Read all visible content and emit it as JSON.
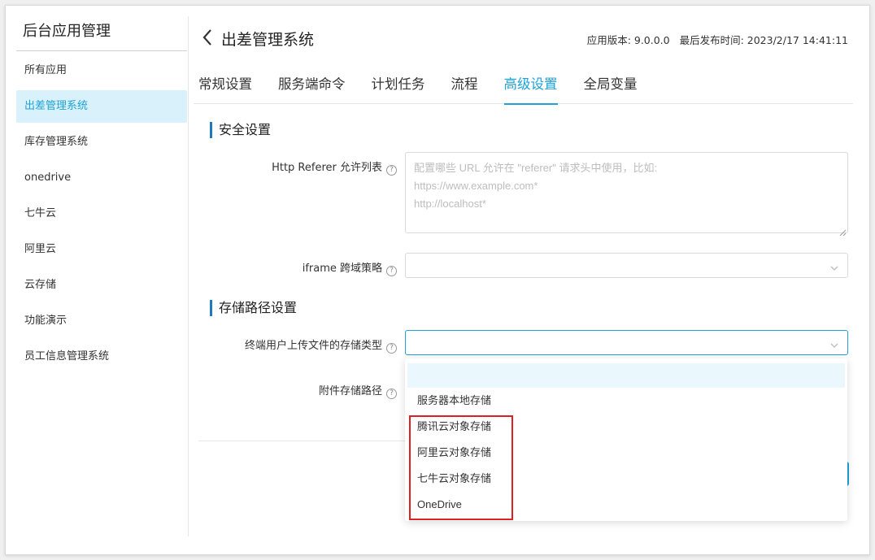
{
  "sidebar": {
    "title": "后台应用管理",
    "items": [
      {
        "label": "所有应用"
      },
      {
        "label": "出差管理系统"
      },
      {
        "label": "库存管理系统"
      },
      {
        "label": "onedrive"
      },
      {
        "label": "七牛云"
      },
      {
        "label": "阿里云"
      },
      {
        "label": "云存储"
      },
      {
        "label": "功能演示"
      },
      {
        "label": "员工信息管理系统"
      }
    ]
  },
  "header": {
    "title": "出差管理系统",
    "version": "应用版本: 9.0.0.0",
    "published": "最后发布时间: 2023/2/17 14:41:11"
  },
  "tabs": [
    {
      "label": "常规设置"
    },
    {
      "label": "服务端命令"
    },
    {
      "label": "计划任务"
    },
    {
      "label": "流程"
    },
    {
      "label": "高级设置"
    },
    {
      "label": "全局变量"
    }
  ],
  "security": {
    "title": "安全设置",
    "referer_label": "Http Referer 允许列表",
    "referer_placeholder": "配置哪些 URL 允许在 \"referer\" 请求头中使用，比如:\nhttps://www.example.com*\nhttp://localhost*",
    "iframe_label": "iframe 跨域策略",
    "iframe_value": ""
  },
  "storage": {
    "title": "存储路径设置",
    "upload_type_label": "终端用户上传文件的存储类型",
    "upload_type_value": "",
    "attachment_label": "附件存储路径",
    "options": [
      "",
      "服务器本地存储",
      "腾讯云对象存储",
      "阿里云对象存储",
      "七牛云对象存储",
      "OneDrive"
    ]
  },
  "colors": {
    "accent": "#1ea2d7",
    "highlight_box": "#e02020"
  }
}
